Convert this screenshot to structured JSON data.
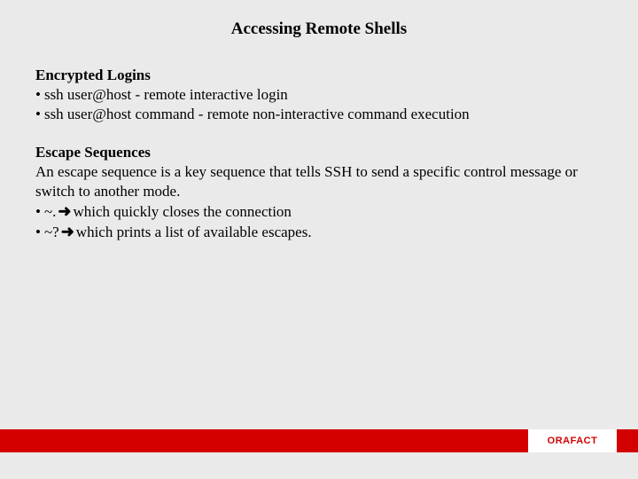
{
  "title": "Accessing Remote Shells",
  "section1": {
    "heading": "Encrypted Logins",
    "items": [
      "ssh user@host - remote interactive login",
      "ssh user@host command - remote non-interactive command execution"
    ]
  },
  "section2": {
    "heading": "Escape Sequences",
    "intro": "An escape sequence is a key sequence that tells SSH to send a specific control message or switch to another mode.",
    "items": [
      {
        "seq": "~.",
        "desc": "which quickly closes the connection"
      },
      {
        "seq": "~?",
        "desc": "which prints a list of available escapes."
      }
    ]
  },
  "footer": {
    "brand": "ORAFACT"
  },
  "glyphs": {
    "bullet": "•",
    "arrow": "➜"
  }
}
